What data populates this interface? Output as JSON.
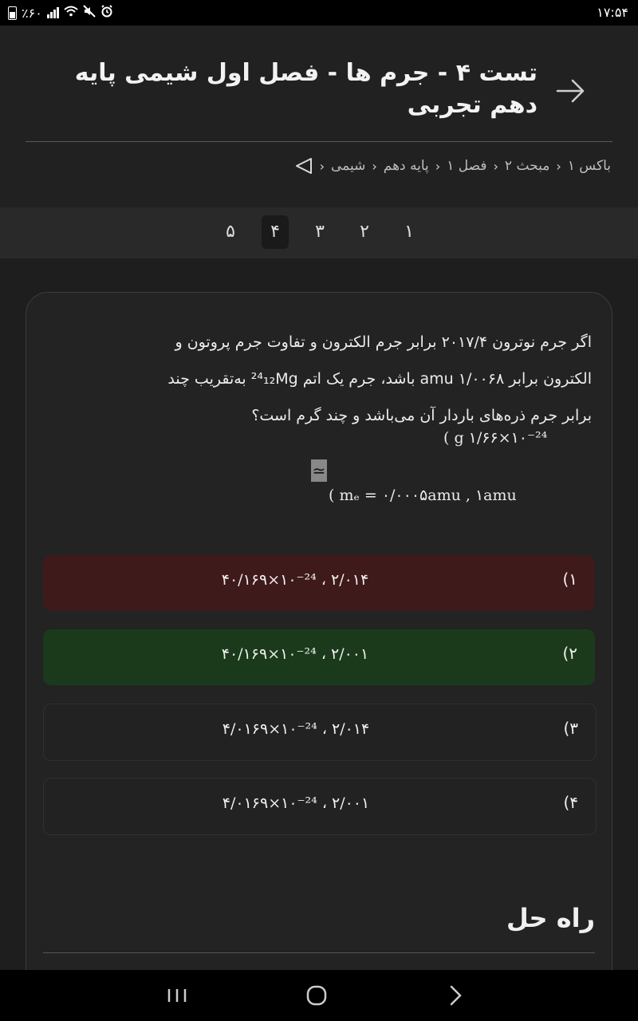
{
  "status": {
    "battery": "٪۶۰",
    "time": "۱۷:۵۴"
  },
  "header": {
    "title": "تست ۴ - جرم ها - فصل اول شیمی پایه دهم تجربی",
    "breadcrumb": [
      "شیمی",
      "پایه دهم",
      "فصل ۱",
      "مبحث ۲",
      "باکس ۱"
    ]
  },
  "pager": {
    "pages": [
      "۱",
      "۲",
      "۳",
      "۴",
      "۵"
    ],
    "active": "۴"
  },
  "question": {
    "line1": "اگر جرم نوترون ۲۰۱۷/۴ برابر جرم الکترون و تفاوت جرم پروتون و",
    "line2": "الکترون برابر ۱/۰۰۶۸ amu باشد، جرم یک اتم ²⁴₁₂Mg به‌تقریب چند",
    "line3": "برابر جرم ذره‌های باردار آن می‌باشد و چند گرم است؟",
    "approx": "( g ۱/۶۶×۱۰⁻²⁴",
    "box": "≃",
    "formula": "( mₑ = ۰/۰۰۰۵amu ,  ۱amu"
  },
  "options": [
    {
      "num": "(۱",
      "text": "۴۰/۱۶۹×۱۰⁻²⁴  ، ۲/۰۱۴",
      "state": "wrong"
    },
    {
      "num": "(۲",
      "text": "۴۰/۱۶۹×۱۰⁻²⁴  ، ۲/۰۰۱",
      "state": "correct"
    },
    {
      "num": "(۳",
      "text": "۴/۰۱۶۹×۱۰⁻²⁴  ، ۲/۰۱۴",
      "state": "none"
    },
    {
      "num": "(۴",
      "text": "۴/۰۱۶۹×۱۰⁻²⁴  ، ۲/۰۰۱",
      "state": "none"
    }
  ],
  "solution": {
    "heading": "راه حل"
  },
  "colors": {
    "wrong": "#3f1a1a",
    "correct": "#1b3a1b",
    "background": "#1e1e1e"
  }
}
